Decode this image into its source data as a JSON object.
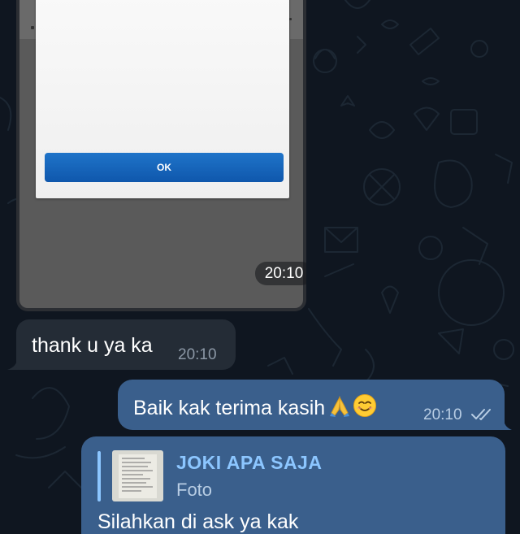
{
  "chat": {
    "image_message": {
      "dialog_button": "OK",
      "time": "20:10"
    },
    "incoming_message": {
      "text": "thank u ya ka",
      "time": "20:10"
    },
    "outgoing_message": {
      "text": "Baik kak terima kasih",
      "emojis": [
        "folded-hands",
        "smiling-face"
      ],
      "time": "20:10",
      "status": "read"
    },
    "reply_message": {
      "quoted_sender": "JOKI APA SAJA",
      "quoted_type": "Foto",
      "text": "Silahkan di ask ya kak"
    }
  },
  "colors": {
    "background": "#0f1620",
    "incoming_bubble": "#242c36",
    "outgoing_bubble": "#3a5f8c",
    "accent": "#8cc6ff",
    "ok_button": "#1565c0"
  }
}
